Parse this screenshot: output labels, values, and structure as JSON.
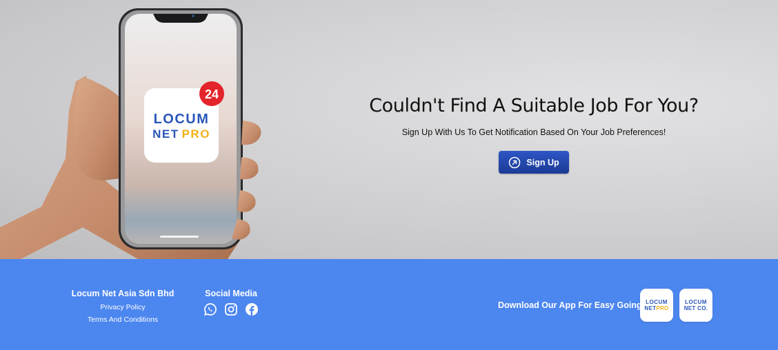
{
  "hero": {
    "heading": "Couldn't Find A Suitable Job For You?",
    "subheading": "Sign Up With Us To Get Notification Based On Your Job Preferences!",
    "signup_label": "Sign Up",
    "phone": {
      "app_logo_line1": "LOCUM",
      "app_logo_net": "NET",
      "app_logo_pro": "PRO",
      "notification_count": "24"
    }
  },
  "footer": {
    "company_name": "Locum Net Asia Sdn Bhd",
    "links": [
      "Privacy Policy",
      "Terms And Conditions"
    ],
    "social_title": "Social Media",
    "social_icons": [
      "whatsapp-icon",
      "instagram-icon",
      "facebook-icon"
    ],
    "download_text": "Download Our App For Easy Going",
    "apps": [
      {
        "line1": "LOCUM",
        "net": "NET",
        "suffix": "PRO"
      },
      {
        "line1": "LOCUM",
        "net": "NET",
        "suffix": "CO."
      }
    ]
  },
  "colors": {
    "footer_bg": "#4c86ef",
    "button_bg": "#2447a8",
    "badge_red": "#e3242b",
    "brand_blue": "#2a56b8",
    "brand_yellow": "#f2b21b"
  }
}
